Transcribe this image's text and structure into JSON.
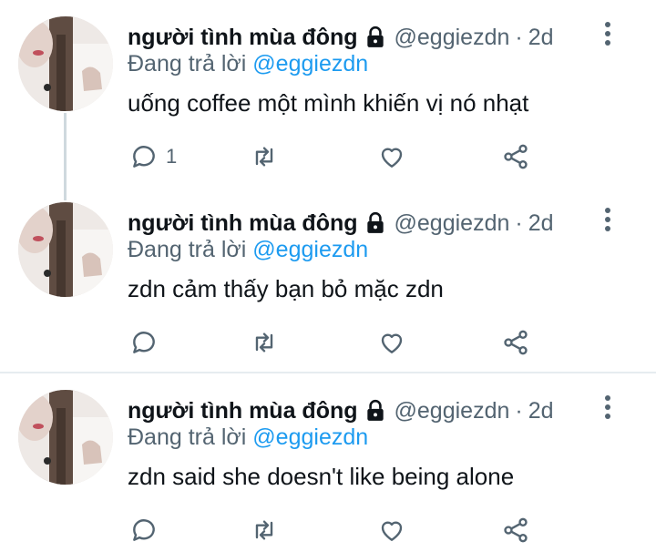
{
  "tweets": [
    {
      "display_name": "người tình mùa đông",
      "handle": "@eggiezdn",
      "separator": "·",
      "time": "2d",
      "reply_prefix": "Đang trả lời",
      "reply_to": "@eggiezdn",
      "text": "uống coffee một mình khiến vị nó nhạt",
      "reply_count": "1"
    },
    {
      "display_name": "người tình mùa đông",
      "handle": "@eggiezdn",
      "separator": "·",
      "time": "2d",
      "reply_prefix": "Đang trả lời",
      "reply_to": "@eggiezdn",
      "text": "zdn cảm thấy bạn bỏ mặc zdn",
      "reply_count": ""
    },
    {
      "display_name": "người tình mùa đông",
      "handle": "@eggiezdn",
      "separator": "·",
      "time": "2d",
      "reply_prefix": "Đang trả lời",
      "reply_to": "@eggiezdn",
      "text": "zdn said she doesn't like being alone",
      "reply_count": ""
    }
  ],
  "colors": {
    "text_primary": "#0f1419",
    "text_secondary": "#536471",
    "link": "#1d9bf0",
    "divider": "#e6ecf0"
  },
  "icons": [
    "lock-icon",
    "more-icon",
    "reply-icon",
    "retweet-icon",
    "like-icon",
    "share-icon"
  ]
}
